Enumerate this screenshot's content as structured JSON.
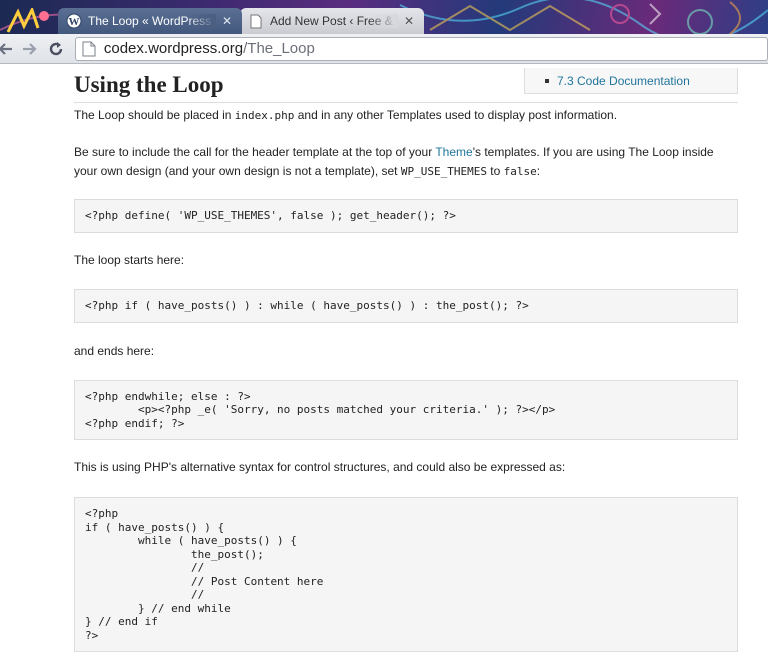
{
  "browser": {
    "tabs": [
      {
        "title": "The Loop « WordPress Codex",
        "active": true,
        "favicon": "wordpress-icon"
      },
      {
        "title": "Add New Post ‹ Free & Premium",
        "active": false,
        "favicon": "page-icon"
      }
    ],
    "close_glyph": "✕",
    "url_domain": "codex.wordpress.org",
    "url_path": "/The_Loop",
    "icons": [
      "back-arrow-icon",
      "forward-arrow-icon",
      "reload-icon",
      "page-icon"
    ]
  },
  "page": {
    "toc_item": "7.3 Code Documentation",
    "title": "Using the Loop",
    "p1": {
      "before": "The Loop should be placed in ",
      "code": "index.php",
      "after": " and in any other Templates used to display post information."
    },
    "p2": {
      "part1": "Be sure to include the call for the header template at the top of your ",
      "link": "Theme",
      "part2": "'s templates. If you are using The Loop inside your own design (and your own design is not a template), set ",
      "code1": "WP_USE_THEMES",
      "part3": " to ",
      "code2": "false",
      "part4": ":"
    },
    "code1": "<?php define( 'WP_USE_THEMES', false ); get_header(); ?>",
    "p3": "The loop starts here:",
    "code2": "<?php if ( have_posts() ) : while ( have_posts() ) : the_post(); ?>",
    "p4": "and ends here:",
    "code3": "<?php endwhile; else : ?>\n\t<p><?php _e( 'Sorry, no posts matched your criteria.' ); ?></p>\n<?php endif; ?>",
    "p5": "This is using PHP's alternative syntax for control structures, and could also be expressed as:",
    "code4": "<?php \nif ( have_posts() ) {\n\twhile ( have_posts() ) {\n\t\tthe_post();\n\t\t//\n\t\t// Post Content here\n\t\t//\n\t} // end while\n} // end if\n?>"
  },
  "colors": {
    "link": "#21759b",
    "code_bg": "#f5f5f5",
    "code_border": "#dcdcdc"
  }
}
